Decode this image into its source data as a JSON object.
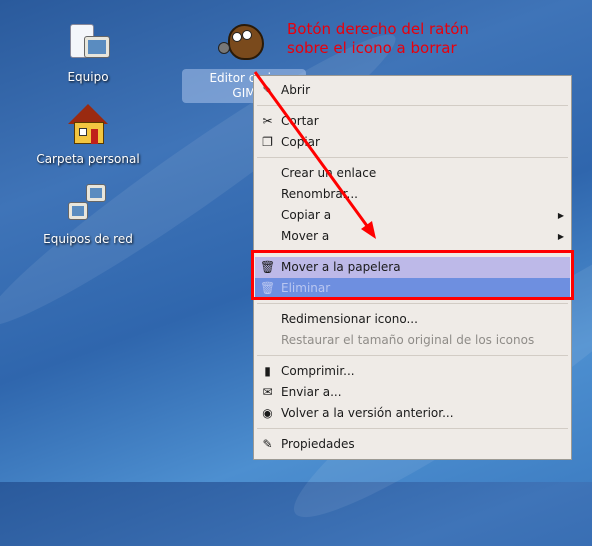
{
  "desktop": {
    "icons": [
      {
        "label": "Equipo",
        "icon": "computer-icon"
      },
      {
        "label": "Carpeta personal",
        "icon": "home-folder-icon"
      },
      {
        "label": "Equipos de red",
        "icon": "network-icon"
      }
    ],
    "selected_icon": {
      "label_line1": "Editor de in",
      "label_line2": "GIM",
      "icon": "gimp-icon"
    }
  },
  "annotation": {
    "line1": "Botón derecho del ratón",
    "line2": "sobre el icono a borrar",
    "color": "#e8000c"
  },
  "context_menu": {
    "items": [
      {
        "label": "Abrir",
        "icon": "open-icon",
        "glyph": "✎"
      },
      {
        "sep": true
      },
      {
        "label": "Cortar",
        "icon": "scissors-icon",
        "glyph": "✂"
      },
      {
        "label": "Copiar",
        "icon": "copy-icon",
        "glyph": "❐"
      },
      {
        "sep": true
      },
      {
        "label": "Crear un enlace"
      },
      {
        "label": "Renombrar..."
      },
      {
        "label": "Copiar a",
        "submenu": true
      },
      {
        "label": "Mover a",
        "submenu": true
      },
      {
        "sep": true
      },
      {
        "label": "Mover a la papelera",
        "icon": "trash-icon",
        "glyph": "🗑",
        "state": "hl1"
      },
      {
        "label": "Eliminar",
        "icon": "trash-icon",
        "glyph": "🗑",
        "state": "hl2"
      },
      {
        "sep": true
      },
      {
        "label": "Redimensionar icono..."
      },
      {
        "label": "Restaurar el tamaño original de los iconos",
        "state": "dis"
      },
      {
        "sep": true
      },
      {
        "label": "Comprimir...",
        "icon": "archive-icon",
        "glyph": "▮"
      },
      {
        "label": "Enviar a...",
        "icon": "send-to-icon",
        "glyph": "✉"
      },
      {
        "label": "Volver a la versión anterior...",
        "icon": "revert-icon",
        "glyph": "◉"
      },
      {
        "sep": true
      },
      {
        "label": "Propiedades",
        "icon": "properties-icon",
        "glyph": "✎"
      }
    ]
  }
}
